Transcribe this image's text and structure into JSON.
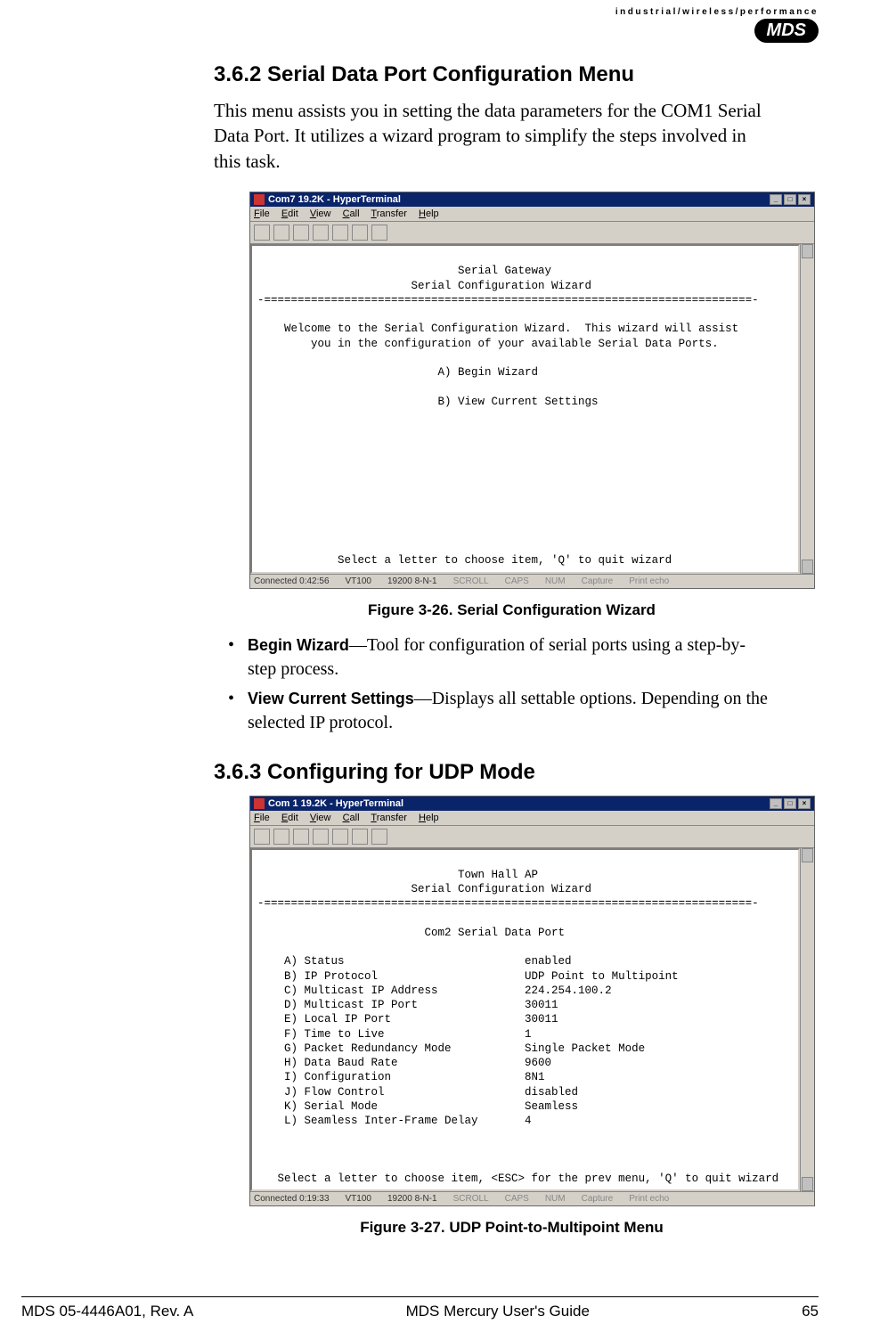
{
  "branding": {
    "tagline": "industrial/wireless/performance",
    "logo": "MDS"
  },
  "sections": {
    "s362": {
      "heading": "3.6.2 Serial Data Port Configuration Menu",
      "intro": "This menu assists you in setting the data parameters for the COM1 Serial Data Port. It utilizes a wizard program to simplify the steps involved in this task."
    },
    "s363": {
      "heading": "3.6.3 Configuring for UDP Mode"
    }
  },
  "figure26": {
    "caption": "Figure 3-26. Serial Configuration Wizard",
    "window_title": "Com7 19.2K - HyperTerminal",
    "menu_items": [
      "File",
      "Edit",
      "View",
      "Call",
      "Transfer",
      "Help"
    ],
    "terminal_text": "\n                              Serial Gateway\n                       Serial Configuration Wizard\n-=========================================================================-\n\n    Welcome to the Serial Configuration Wizard.  This wizard will assist\n        you in the configuration of your available Serial Data Ports.\n\n                           A) Begin Wizard\n\n                           B) View Current Settings\n\n\n\n\n\n\n\n\n\n\n            Select a letter to choose item, 'Q' to quit wizard",
    "status": {
      "connected": "Connected 0:42:56",
      "emulation": "VT100",
      "settings": "19200 8-N-1",
      "flags": [
        "SCROLL",
        "CAPS",
        "NUM",
        "Capture",
        "Print echo"
      ]
    }
  },
  "bullets": [
    {
      "term": "Begin Wizard",
      "desc": "—Tool for configuration of serial ports using a step-by-step process."
    },
    {
      "term": "View Current Settings",
      "desc": "—Displays all settable options. Depending on the selected IP protocol."
    }
  ],
  "figure27": {
    "caption": "Figure 3-27. UDP Point-to-Multipoint Menu",
    "window_title": "Com 1 19.2K - HyperTerminal",
    "menu_items": [
      "File",
      "Edit",
      "View",
      "Call",
      "Transfer",
      "Help"
    ],
    "terminal_text": "\n                              Town Hall AP\n                       Serial Configuration Wizard\n-=========================================================================-\n\n                         Com2 Serial Data Port\n\n    A) Status                           enabled\n    B) IP Protocol                      UDP Point to Multipoint\n    C) Multicast IP Address             224.254.100.2\n    D) Multicast IP Port                30011\n    E) Local IP Port                    30011\n    F) Time to Live                     1\n    G) Packet Redundancy Mode           Single Packet Mode\n    H) Data Baud Rate                   9600\n    I) Configuration                    8N1\n    J) Flow Control                     disabled\n    K) Serial Mode                      Seamless\n    L) Seamless Inter-Frame Delay       4\n\n\n\n   Select a letter to choose item, <ESC> for the prev menu, 'Q' to quit wizard",
    "status": {
      "connected": "Connected 0:19:33",
      "emulation": "VT100",
      "settings": "19200 8-N-1",
      "flags": [
        "SCROLL",
        "CAPS",
        "NUM",
        "Capture",
        "Print echo"
      ]
    }
  },
  "footer": {
    "left": "MDS 05-4446A01, Rev. A",
    "center": "MDS Mercury User's Guide",
    "right": "65"
  }
}
